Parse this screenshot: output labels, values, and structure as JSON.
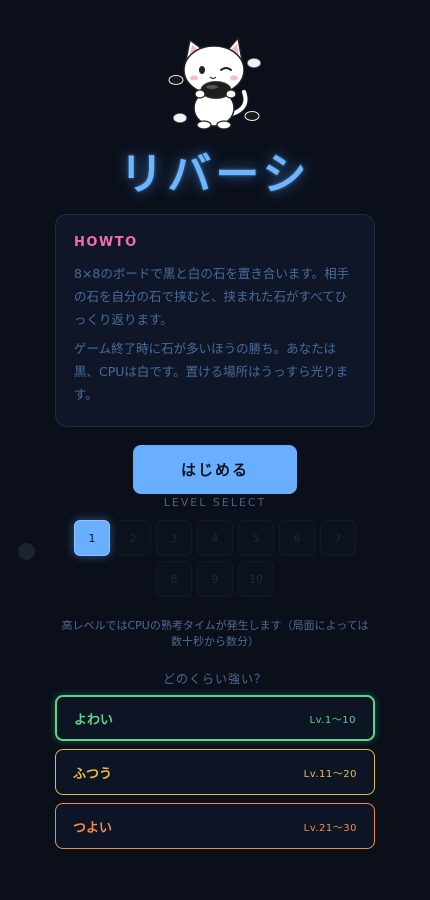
{
  "app": {
    "title": "リバーシ"
  },
  "howto": {
    "heading": "HOWTO",
    "paragraph1": "8×8のボードで黒と白の石を置き合います。相手の石を自分の石で挟むと、挟まれた石がすべてひっくり返ります。",
    "paragraph2": "ゲーム終了時に石が多いほうの勝ち。あなたは黒、CPUは白です。置ける場所はうっすら光ります。"
  },
  "start": {
    "label": "はじめる"
  },
  "level_select": {
    "label": "LEVEL SELECT",
    "selected": 1,
    "levels": [
      "1",
      "2",
      "3",
      "4",
      "5",
      "6",
      "7",
      "8",
      "9",
      "10"
    ]
  },
  "note": "高レベルではCPUの熟考タイムが発生します（局面によっては数十秒から数分）",
  "difficulty": {
    "question": "どのくらい強い？",
    "options": [
      {
        "name": "よわい",
        "range": "Lv.1〜10",
        "color": "#5fd18c"
      },
      {
        "name": "ふつう",
        "range": "Lv.11〜20",
        "color": "#e8bf4a"
      },
      {
        "name": "つよい",
        "range": "Lv.21〜30",
        "color": "#f08c4c"
      }
    ]
  },
  "icons": {
    "mascot": "cat-mascot-icon"
  },
  "colors": {
    "background": "#0a0f1a",
    "accent": "#6aafff",
    "howto_heading": "#f26ea8"
  }
}
